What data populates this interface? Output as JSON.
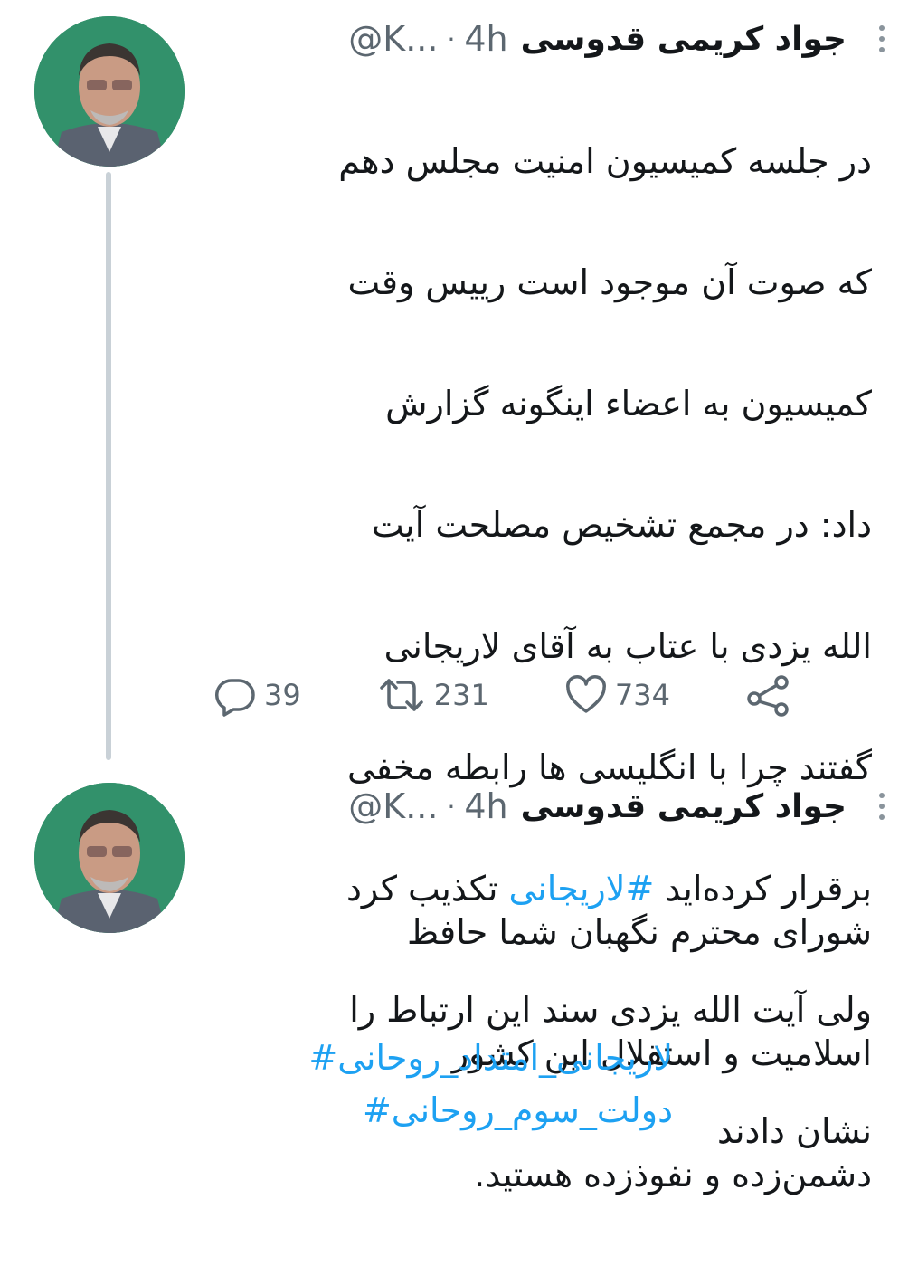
{
  "thread": [
    {
      "author": {
        "name": "جواد کریمی قدوسی",
        "handle": "@K...",
        "time": "4h"
      },
      "text_lines": [
        "در جلسه کمیسیون امنیت مجلس دهم",
        "که صوت آن موجود است رییس وقت",
        "کمیسیون به اعضاء اینگونه گزارش",
        "داد: در مجمع تشخیص مصلحت آیت",
        "الله یزدی با عتاب به آقای لاریجانی",
        "گفتند چرا با انگلیسی ها رابطه مخفی"
      ],
      "line7_pre": "برقرار کرده‌اید ",
      "line7_hashtag": "#لاریجانی",
      "line7_post": " تکذیب کرد",
      "text_lines_end": [
        "ولی آیت الله یزدی سند این ارتباط را",
        "نشان دادند"
      ],
      "actions": {
        "replies": "39",
        "retweets": "231",
        "likes": "734"
      }
    },
    {
      "author": {
        "name": "جواد کریمی قدوسی",
        "handle": "@K...",
        "time": "4h"
      },
      "text_lines": [
        "شورای محترم نگهبان شما حافظ",
        "اسلامیت و استقلال این کشور",
        "دشمن‌زده و نفوذزده هستید."
      ],
      "hashtags": [
        "لاریجانی_امتداد_روحانی#",
        "دولت_سوم_روحانی#"
      ]
    }
  ],
  "colors": {
    "hashtag": "#1da1f2",
    "meta": "#5c6770",
    "thread_line": "#c9d1d7"
  },
  "icons": [
    "reply-icon",
    "retweet-icon",
    "like-icon",
    "share-icon",
    "more-icon"
  ]
}
